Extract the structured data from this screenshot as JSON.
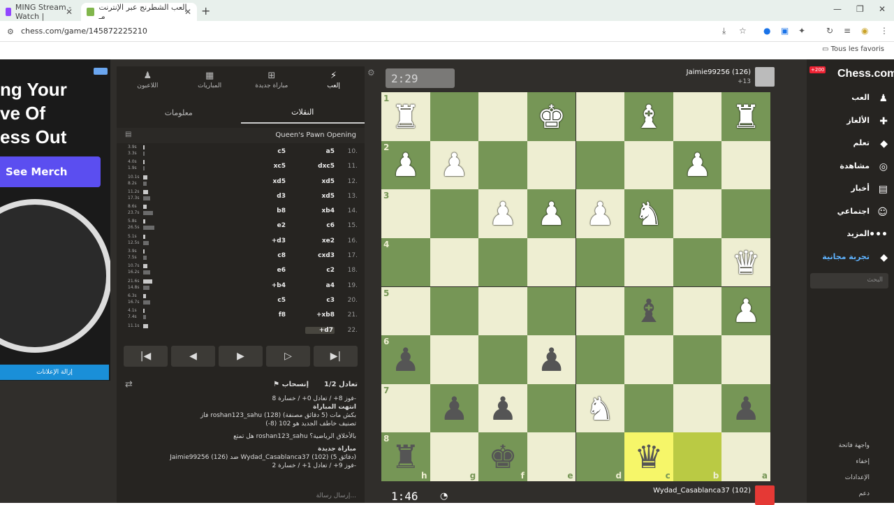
{
  "browser": {
    "tabs": [
      {
        "label": "MING Stream - Watch |"
      },
      {
        "label": "إلعب الشطرنج عبر الإنترنت مـ"
      }
    ],
    "url": "chess.com/game/145872225210",
    "favorites_label": "Tous les favoris"
  },
  "ad": {
    "title": "ng Your\nve Of\ness Out",
    "button": "See Merch",
    "remove": "إزالة الإعلانات"
  },
  "panel": {
    "tabs": [
      {
        "label": "إلعب",
        "icon": "bolt-icon"
      },
      {
        "label": "مباراة جديدة",
        "icon": "plus-icon"
      },
      {
        "label": "المباريات",
        "icon": "board-icon"
      },
      {
        "label": "اللاعبون",
        "icon": "players-icon"
      }
    ],
    "subtabs": [
      {
        "label": "النقلات"
      },
      {
        "label": "معلومات"
      }
    ],
    "opening": "Queen's Pawn Opening",
    "moves": [
      {
        "n": "10.",
        "w": "a5",
        "b": "c5",
        "tw": "3.9s",
        "tb": "3.3s"
      },
      {
        "n": "11.",
        "w": "dxc5",
        "b": "xc5",
        "tw": "4.0s",
        "tb": "1.9s"
      },
      {
        "n": "12.",
        "w": "xd5",
        "b": "xd5",
        "tw": "10.1s",
        "tb": "8.2s"
      },
      {
        "n": "13.",
        "w": "xd5",
        "b": "d3",
        "tw": "11.2s",
        "tb": "17.3s"
      },
      {
        "n": "14.",
        "w": "xb4",
        "b": "b8",
        "tw": "8.6s",
        "tb": "23.7s"
      },
      {
        "n": "15.",
        "w": "c6",
        "b": "e2",
        "tw": "5.8s",
        "tb": "26.5s"
      },
      {
        "n": "16.",
        "w": "xe2",
        "b": "+d3",
        "tw": "5.1s",
        "tb": "12.5s"
      },
      {
        "n": "17.",
        "w": "cxd3",
        "b": "c8",
        "tw": "3.9s",
        "tb": "7.5s"
      },
      {
        "n": "18.",
        "w": "c2",
        "b": "e6",
        "tw": "10.7s",
        "tb": "16.2s"
      },
      {
        "n": "19.",
        "w": "a4",
        "b": "+b4",
        "tw": "21.6s",
        "tb": "14.8s"
      },
      {
        "n": "20.",
        "w": "c3",
        "b": "c5",
        "tw": "6.3s",
        "tb": "16.7s"
      },
      {
        "n": "21.",
        "w": "+xb8",
        "b": "f8",
        "tw": "4.1s",
        "tb": "7.4s"
      },
      {
        "n": "22.",
        "w": "+d7",
        "b": "",
        "tw": "11.1s",
        "tb": ""
      }
    ],
    "draw": "تعادل 1/2",
    "resign": "إنسحاب",
    "chat": [
      {
        "text": "فوز 8+ / تعادل 0+ / خسارة 8-",
        "bold": false
      },
      {
        "text": "انتهت المباراة",
        "bold": true
      },
      {
        "text": "فاز roshan123_sahu (128) بكش مات (5 دقائق مصنفة)",
        "bold": false
      },
      {
        "text": "تصنيف خاطف الجديد هو 102 (8-)",
        "bold": false
      },
      {
        "text": "هل تمتع roshan123_sahu بالأخلاق الرياضية؟",
        "bold": false
      },
      {
        "text": "مباراة جديدة",
        "bold": true
      },
      {
        "text": "Jaimie99256 (126) ضد Wydad_Casablanca37 (102) (5 دقائق)",
        "bold": false
      },
      {
        "text": "فوز 9+ / تعادل 1+ / خسارة 2-",
        "bold": false
      }
    ],
    "message_placeholder": "إرسال رسالة..."
  },
  "game": {
    "opponent_clock": "2:29",
    "opponent": "Jaimie99256 (126)",
    "opponent_material": "+13",
    "my_clock": "1:46",
    "me": "Wydad_Casablanca37 (102)",
    "ranks": [
      "1",
      "2",
      "3",
      "4",
      "5",
      "6",
      "7",
      "8"
    ],
    "files": [
      "h",
      "g",
      "f",
      "e",
      "d",
      "c",
      "b",
      "a"
    ],
    "pieces": [
      {
        "sq": "h1",
        "g": "♜",
        "c": "w"
      },
      {
        "sq": "e1",
        "g": "♚",
        "c": "w"
      },
      {
        "sq": "c1",
        "g": "♝",
        "c": "w"
      },
      {
        "sq": "a1",
        "g": "♜",
        "c": "w"
      },
      {
        "sq": "h2",
        "g": "♟",
        "c": "w"
      },
      {
        "sq": "g2",
        "g": "♟",
        "c": "w"
      },
      {
        "sq": "b2",
        "g": "♟",
        "c": "w"
      },
      {
        "sq": "f3",
        "g": "♟",
        "c": "w"
      },
      {
        "sq": "e3",
        "g": "♟",
        "c": "w"
      },
      {
        "sq": "d3",
        "g": "♟",
        "c": "w"
      },
      {
        "sq": "c3",
        "g": "♞",
        "c": "w"
      },
      {
        "sq": "a4",
        "g": "♛",
        "c": "w"
      },
      {
        "sq": "c5",
        "g": "♝",
        "c": "b"
      },
      {
        "sq": "a5",
        "g": "♟",
        "c": "w"
      },
      {
        "sq": "h6",
        "g": "♟",
        "c": "b"
      },
      {
        "sq": "e6",
        "g": "♟",
        "c": "b"
      },
      {
        "sq": "g7",
        "g": "♟",
        "c": "b"
      },
      {
        "sq": "f7",
        "g": "♟",
        "c": "b"
      },
      {
        "sq": "d7",
        "g": "♞",
        "c": "w"
      },
      {
        "sq": "a7",
        "g": "♟",
        "c": "b"
      },
      {
        "sq": "h8",
        "g": "♜",
        "c": "b"
      },
      {
        "sq": "f8",
        "g": "♚",
        "c": "b"
      },
      {
        "sq": "c8",
        "g": "♛",
        "c": "b"
      }
    ],
    "highlight": [
      "c8",
      "b8"
    ]
  },
  "sidebar": {
    "logo": "Chess.com",
    "badge": "+200",
    "items": [
      {
        "label": "العب",
        "icon": "pawn-icon"
      },
      {
        "label": "الألغاز",
        "icon": "puzzle-icon"
      },
      {
        "label": "تعلم",
        "icon": "learn-icon"
      },
      {
        "label": "مشاهدة",
        "icon": "binoculars-icon"
      },
      {
        "label": "أخبار",
        "icon": "news-icon"
      },
      {
        "label": "اجتماعي",
        "icon": "social-icon"
      },
      {
        "label": "المزيد",
        "icon": "more-icon"
      },
      {
        "label": "تجربة مجانية",
        "icon": "diamond-icon"
      }
    ],
    "search_placeholder": "البحث",
    "bottom": [
      {
        "label": "واجهة فاتحة"
      },
      {
        "label": "إخفاء"
      },
      {
        "label": "الإعدادات"
      },
      {
        "label": "دعم"
      }
    ]
  }
}
